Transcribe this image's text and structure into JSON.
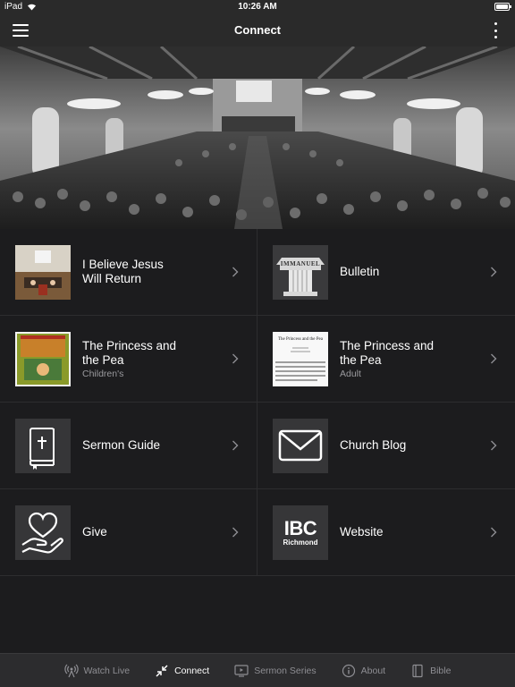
{
  "status": {
    "device": "iPad",
    "time": "10:26 AM"
  },
  "nav": {
    "title": "Connect"
  },
  "tiles": [
    {
      "title": "I Believe Jesus\nWill Return",
      "subtitle": "",
      "icon": "sermon-video-thumbnail"
    },
    {
      "title": "Bulletin",
      "subtitle": "",
      "icon": "immanuel-column-logo",
      "thumb_text": "IMMANUEL"
    },
    {
      "title": "The Princess and\nthe Pea",
      "subtitle": "Children's",
      "icon": "children-book-cover"
    },
    {
      "title": "The Princess and\nthe Pea",
      "subtitle": "Adult",
      "icon": "text-document-thumbnail",
      "thumb_text": "The Princess and the Pea"
    },
    {
      "title": "Sermon Guide",
      "subtitle": "",
      "icon": "bible-book-icon"
    },
    {
      "title": "Church Blog",
      "subtitle": "",
      "icon": "envelope-icon"
    },
    {
      "title": "Give",
      "subtitle": "",
      "icon": "heart-hand-icon"
    },
    {
      "title": "Website",
      "subtitle": "",
      "icon": "ibc-logo",
      "logo_main": "IBC",
      "logo_sub": "Richmond"
    }
  ],
  "tabs": [
    {
      "label": "Watch Live",
      "icon": "broadcast-icon",
      "active": false
    },
    {
      "label": "Connect",
      "icon": "connect-arrows-icon",
      "active": true
    },
    {
      "label": "Sermon Series",
      "icon": "video-screen-icon",
      "active": false
    },
    {
      "label": "About",
      "icon": "info-icon",
      "active": false
    },
    {
      "label": "Bible",
      "icon": "book-icon",
      "active": false
    }
  ],
  "colors": {
    "background": "#1c1c1e",
    "bar": "#2a2a2a",
    "divider": "#2d2d2f",
    "inactive_tab": "#8e8e93",
    "subtitle": "#9a9a9e"
  }
}
